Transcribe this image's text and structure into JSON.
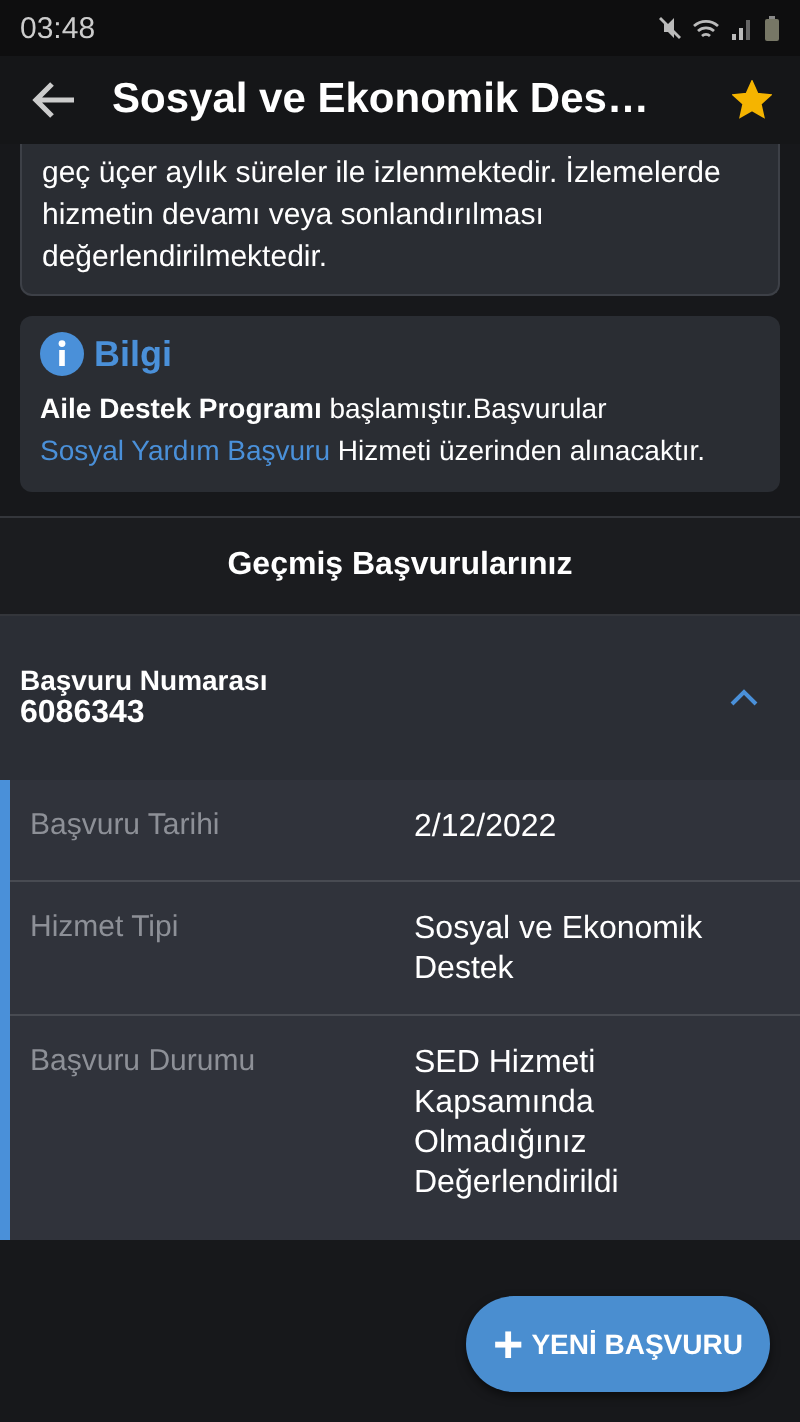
{
  "status_bar": {
    "time": "03:48"
  },
  "header": {
    "title": "Sosyal ve Ekonomik Des…",
    "favorite": true
  },
  "description": "geç üçer aylık süreler ile izlenmektedir. İzlemelerde hizmetin devamı veya sonlandırılması değerlendirilmektedir.",
  "info": {
    "title": "Bilgi",
    "text": "**Aile Destek Programı** başlamıştır.Başvurular",
    "link": "Sosyal Yardım Başvuru",
    "text_after": "Hizmeti üzerinden alınacaktır."
  },
  "history_title": "Geçmiş Başvurularınız",
  "application": {
    "number_label": "Başvuru Numarası",
    "number": "6086343",
    "expanded": true,
    "fields": [
      {
        "label": "Başvuru Tarihi",
        "value": "2/12/2022"
      },
      {
        "label": "Hizmet Tipi",
        "value": "Sosyal ve Ekonomik Destek"
      },
      {
        "label": "Başvuru Durumu",
        "value": "SED Hizmeti Kapsamında Olmadığınız Değerlendirildi"
      }
    ]
  },
  "new_button": {
    "icon": "+",
    "label": "YENİ BAŞVURU"
  }
}
